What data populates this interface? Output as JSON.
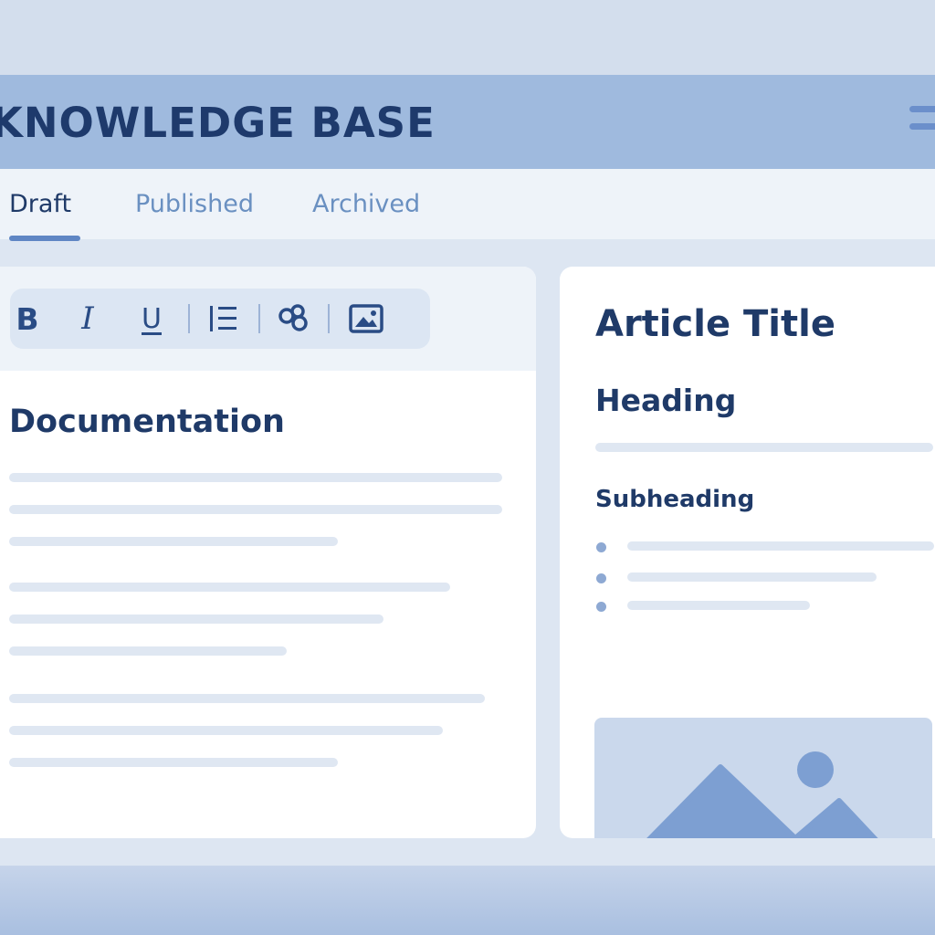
{
  "app": {
    "title": "KNOWLEDGE BASE"
  },
  "header": {
    "menu_icon": "hamburger-menu-icon"
  },
  "tabs": [
    {
      "label": "Draft",
      "active": true
    },
    {
      "label": "Published",
      "active": false
    },
    {
      "label": "Archived",
      "active": false
    }
  ],
  "toolbar": {
    "bold_label": "B",
    "italic_label": "I",
    "underline_label": "U",
    "icons": [
      "bold-icon",
      "italic-icon",
      "underline-icon",
      "list-icon",
      "link-icon",
      "image-icon"
    ]
  },
  "editor": {
    "title": "Documentation"
  },
  "preview": {
    "title": "Article Title",
    "heading": "Heading",
    "subheading": "Subheading",
    "image_icon": "image-placeholder-icon"
  },
  "colors": {
    "header_bg": "#9fbade",
    "accent": "#5f86c4",
    "text_dark": "#1f3a68",
    "tab_inactive": "#6a90c1",
    "placeholder_line": "#dfe7f2"
  }
}
